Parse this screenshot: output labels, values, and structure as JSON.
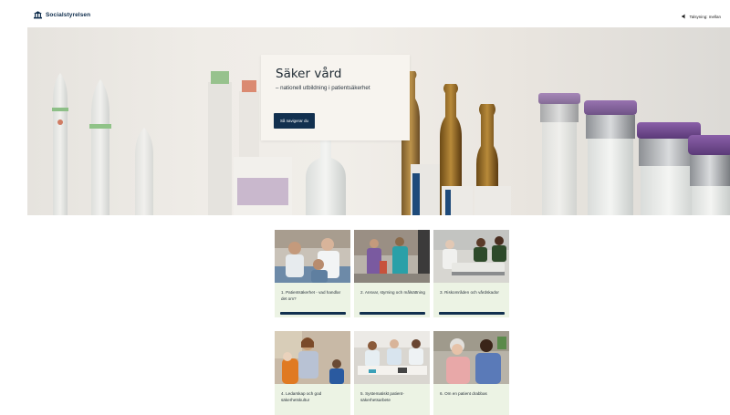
{
  "header": {
    "logo_text": "Socialstyrelsen",
    "speech_label": "Talsyning: mellan",
    "icons": {
      "logo": "socialstyrelsen-logo-icon",
      "speech": "speaker-icon"
    }
  },
  "hero": {
    "title": "Säker vård",
    "subtitle": "– nationell utbildning i patientsäkerhet",
    "button_label": "Så navigerar du"
  },
  "modules": [
    {
      "label": "1. Patientsäkerhet - vad handlar det om?",
      "progress": 1.0
    },
    {
      "label": "2. Ansvar, styrning och målsättning",
      "progress": 1.0
    },
    {
      "label": "3. Riskområden och vårdskador",
      "progress": 1.0
    },
    {
      "label": "4. Ledarskap och god säkerhetskultur",
      "progress": 0
    },
    {
      "label": "5. Systematiskt patient-säkerhetsarbete",
      "progress": 0
    },
    {
      "label": "6. Om en patient drabbas",
      "progress": 0
    }
  ],
  "colors": {
    "primary": "#12304f",
    "card_bg": "#ecf3e4",
    "hero_card_bg": "#f7f4ef"
  }
}
